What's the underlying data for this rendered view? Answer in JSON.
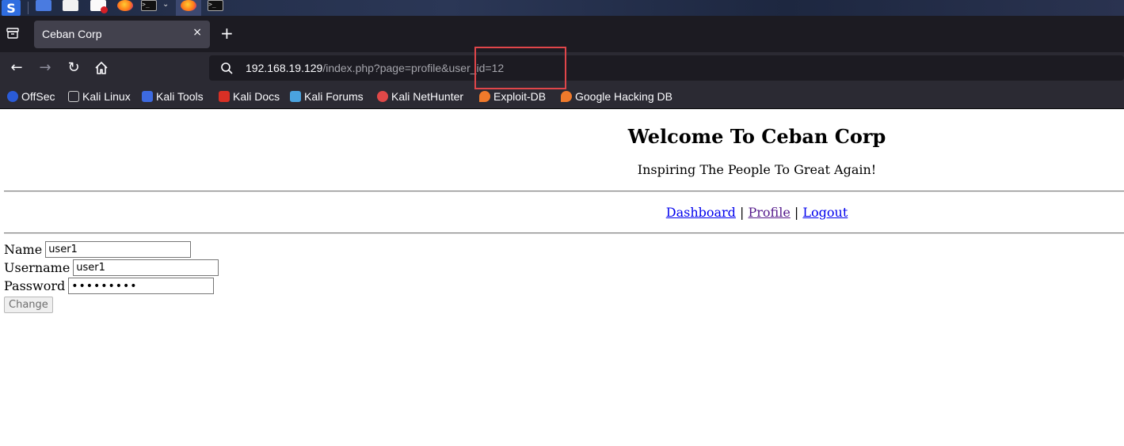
{
  "taskbar": {
    "apps": [
      "kali-menu",
      "files",
      "folder",
      "text-editor",
      "firefox",
      "terminal",
      "firefox-active",
      "terminal"
    ]
  },
  "browser": {
    "tab": {
      "title": "Ceban Corp",
      "close": "×"
    },
    "new_tab": "+",
    "url": {
      "host": "192.168.19.129",
      "path": "/index.php?page=profile&user_id=12"
    },
    "bookmarks": [
      {
        "label": "OffSec",
        "icon": "offsec-icon",
        "color": "#2a5bd7"
      },
      {
        "label": "Kali Linux",
        "icon": "kali-dragon-icon",
        "color": "#cfcfcf"
      },
      {
        "label": "Kali Tools",
        "icon": "kali-tools-icon",
        "color": "#3d6ae0"
      },
      {
        "label": "Kali Docs",
        "icon": "kali-docs-icon",
        "color": "#d93025"
      },
      {
        "label": "Kali Forums",
        "icon": "kali-forums-icon",
        "color": "#4aa3df"
      },
      {
        "label": "Kali NetHunter",
        "icon": "nethunter-icon",
        "color": "#e04848"
      },
      {
        "label": "Exploit-DB",
        "icon": "exploit-db-icon",
        "color": "#f07a2b"
      },
      {
        "label": "Google Hacking DB",
        "icon": "ghdb-icon",
        "color": "#f07a2b"
      }
    ]
  },
  "page": {
    "title": "Welcome To Ceban Corp",
    "subtitle": "Inspiring The People To Great Again!",
    "nav": {
      "dashboard": "Dashboard",
      "sep": "|",
      "profile": "Profile",
      "logout": "Logout"
    },
    "form": {
      "name_label": "Name",
      "name_value": "user1",
      "username_label": "Username",
      "username_value": "user1",
      "password_label": "Password",
      "password_value": "•••••••••",
      "submit_label": "Change"
    }
  }
}
